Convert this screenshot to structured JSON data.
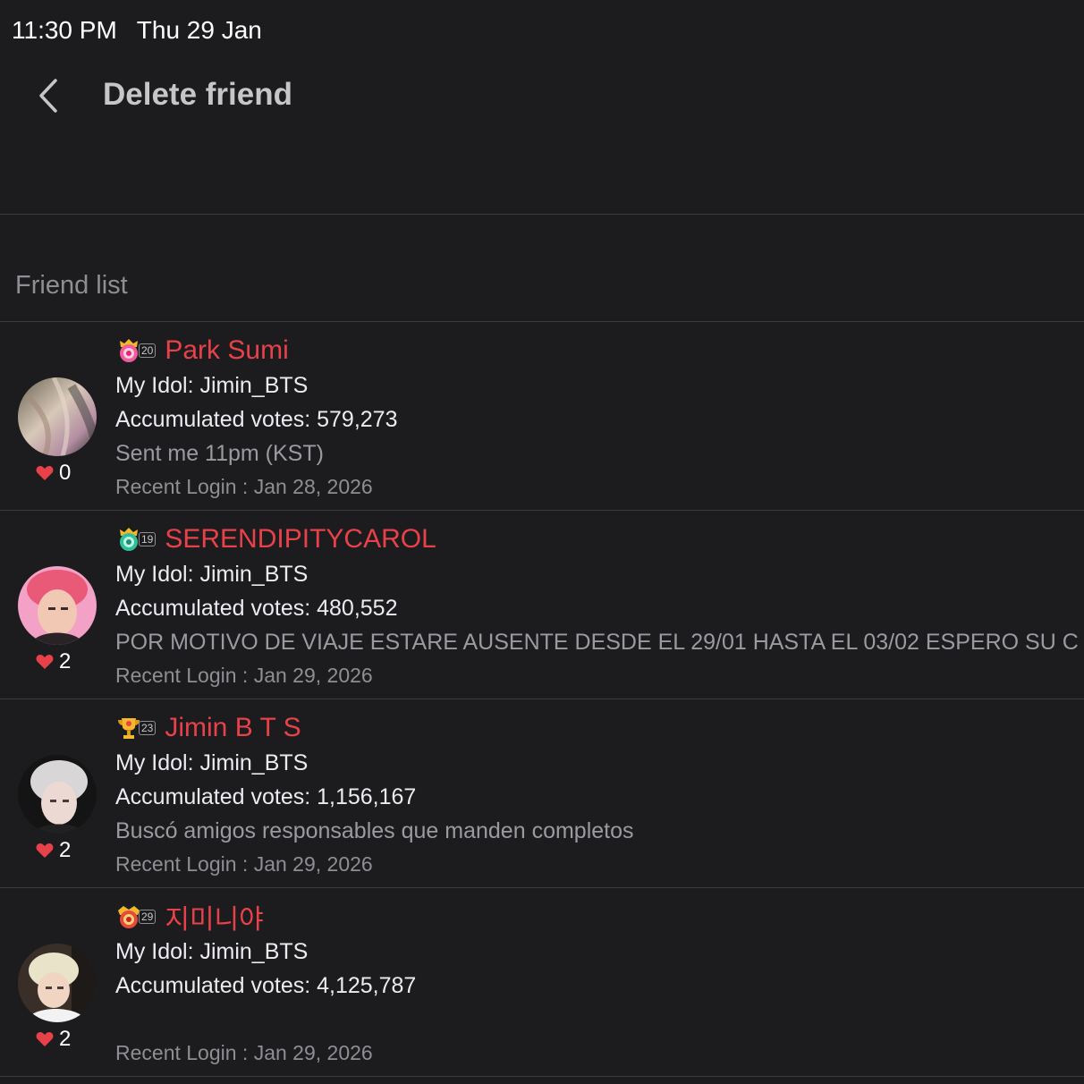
{
  "status_bar": {
    "time": "11:30 PM",
    "date": "Thu 29 Jan"
  },
  "nav": {
    "back_icon": "chevron-left-icon",
    "title": "Delete friend"
  },
  "section_header": "Friend list",
  "colors": {
    "background": "#1c1c1e",
    "name": "#e8414a",
    "heart": "#e8414a",
    "divider": "#3a3a3c"
  },
  "friends": [
    {
      "level": "20",
      "badge_icon": "pink-crest-badge-icon",
      "name": "Park Sumi",
      "idol": "My Idol: Jimin_BTS",
      "votes": "Accumulated votes: 579,273",
      "message": "Sent me 11pm (KST)",
      "login": "Recent Login : Jan 28, 2026",
      "likes": "0"
    },
    {
      "level": "19",
      "badge_icon": "green-crest-badge-icon",
      "name": "SERENDIPITYCAROL",
      "idol": "My Idol: Jimin_BTS",
      "votes": "Accumulated votes: 480,552",
      "message": "POR MOTIVO DE VIAJE ESTARE AUSENTE DESDE EL 29/01 HASTA EL 03/02 ESPERO SU C",
      "login": "Recent Login : Jan 29, 2026",
      "likes": "2"
    },
    {
      "level": "23",
      "badge_icon": "gold-trophy-badge-icon",
      "name": "Jimin B T S",
      "idol": "My Idol: Jimin_BTS",
      "votes": "Accumulated votes: 1,156,167",
      "message": "Buscó amigos responsables que manden completos",
      "login": "Recent Login : Jan 29, 2026",
      "likes": "2"
    },
    {
      "level": "29",
      "badge_icon": "red-gold-crest-badge-icon",
      "name": "지미니야",
      "idol": "My Idol: Jimin_BTS",
      "votes": "Accumulated votes: 4,125,787",
      "message": "",
      "login": "Recent Login : Jan 29, 2026",
      "likes": "2"
    }
  ]
}
